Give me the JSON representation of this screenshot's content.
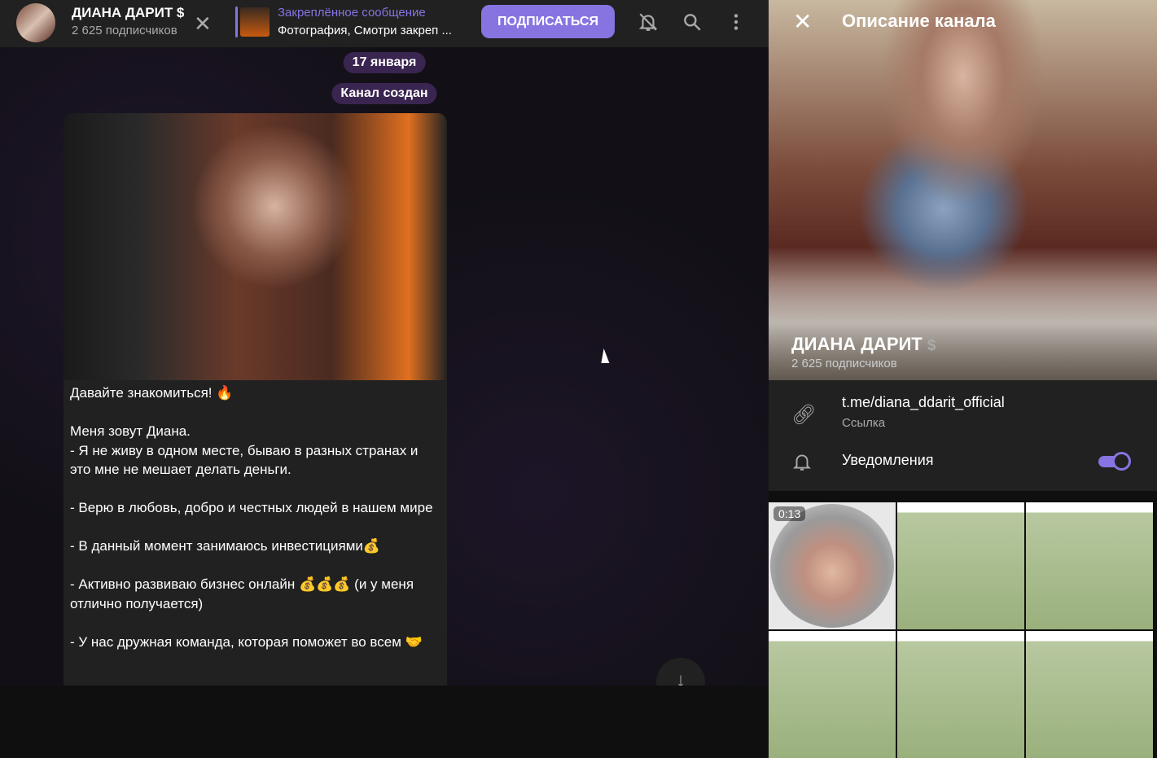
{
  "header": {
    "title": "ДИАНА ДАРИТ $",
    "subscribers": "2 625 подписчиков",
    "pinned_title": "Закреплённое сообщение",
    "pinned_text": "Фотография, Смотри закреп ...",
    "subscribe_label": "ПОДПИСАТЬСЯ",
    "icons": [
      "close-icon",
      "mute-bell-icon",
      "search-icon",
      "more-icon"
    ]
  },
  "chat": {
    "date": "17 января",
    "service": "Канал создан",
    "message": "Давайте знакомиться! 🔥\n\nМеня зовут Диана.\n- Я не живу в одном месте, бываю в разных странах и это мне не мешает делать деньги.\n\n- Верю в любовь, добро и честных людей в нашем мире\n\n- В данный момент занимаюсь инвестициями💰\n\n- Активно развиваю бизнес онлайн 💰💰💰 (и у меня отлично получается)\n\n- У нас дружная команда, которая поможет во всем 🤝"
  },
  "panel": {
    "title": "Описание канала",
    "name": "ДИАНА ДАРИТ",
    "name_suffix": "$",
    "subscribers": "2 625 подписчиков",
    "link": "t.me/diana_ddarit_official",
    "link_label": "Ссылка",
    "notifications_label": "Уведомления",
    "notifications_on": true,
    "media": [
      {
        "type": "video",
        "duration": "0:13"
      },
      {
        "type": "photo"
      },
      {
        "type": "photo"
      },
      {
        "type": "photo"
      },
      {
        "type": "photo"
      },
      {
        "type": "photo"
      }
    ]
  }
}
